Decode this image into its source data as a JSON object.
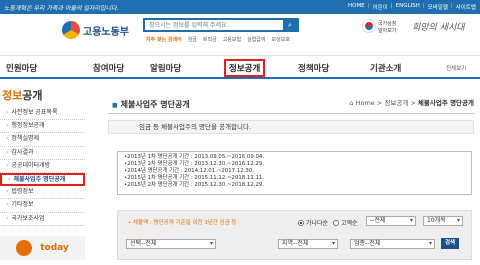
{
  "topbar": {
    "slogan": "노동개혁은 우리 가족과 아들의 일자리입니다.",
    "links": [
      "HOME",
      "어린이",
      "ENGLISH",
      "모바일웹",
      "사이트맵"
    ]
  },
  "header": {
    "logo_text": "고용노동부",
    "search_placeholder": "찾으시는 정보를 입력해 주세요",
    "quick_links": [
      "자주 찾는 검색어",
      "임금",
      "퇴직금",
      "고용보험",
      "실업급여",
      "모성보호"
    ],
    "flag_text_1": "국가상징",
    "flag_text_2": "알아보기",
    "motto": "희망의 새시대"
  },
  "gnb": {
    "items": [
      "민원마당",
      "참여마당",
      "알림마당",
      "정보공개",
      "정책마당",
      "기관소개"
    ],
    "all_menu": "전체보기"
  },
  "sidebar": {
    "title_accent": "정보",
    "title_rest": "공개",
    "items": [
      "사전정보 공표목록",
      "행정정보공개",
      "정책실명제",
      "감사결과",
      "공공데이터개방",
      "체불사업주 명단공개",
      "법령정보",
      "기타정보",
      "국가보조사업"
    ],
    "banner": "today"
  },
  "breadcrumb": {
    "home": "Home",
    "path": "> 정보공개 >",
    "current": "체불사업주 명단공개"
  },
  "main": {
    "title": "체불사업주 명단공개",
    "intro": "임금 등 체불사업주의 명단을 공개합니다.",
    "notice_lines": [
      "•2013년 1차 명단공개 기간 : 2013.09.05.~2016.09.04.",
      "•2013년 2차 명단공개 기간 : 2013.12.30.~2016.12.29.",
      "•2014년 명단공개 기간 : 2014.12.01.~2017.12.30.",
      "•2015년 1차 명단공개 기간 : 2015.11.12.~2018.11.11.",
      "•2015년 2차 명단공개 기간 : 2015.12.30.~2018.12.29."
    ]
  },
  "filter": {
    "note": "• 체불액 : 명단공개 기준일 이전 3년간 임금 등",
    "radio_1": "가나다순",
    "radio_2": "고액순",
    "sort_select": "--전체",
    "count_select": "10개씩",
    "region_select": "선택--전체",
    "area_select": "지역--전체",
    "industry_select": "업종--전체",
    "search_button": "검색"
  }
}
